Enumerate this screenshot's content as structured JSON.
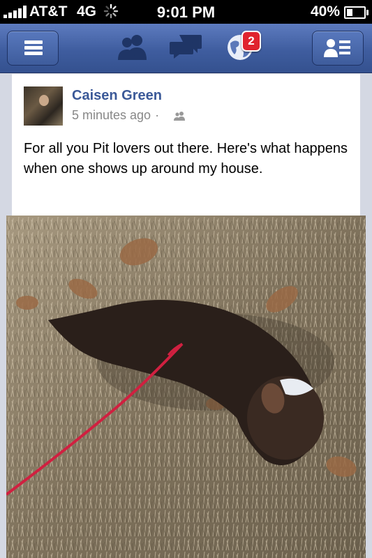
{
  "status_bar": {
    "carrier": "AT&T",
    "network": "4G",
    "time": "9:01 PM",
    "battery": "40%",
    "battery_level": 0.4
  },
  "nav": {
    "notification_count": "2",
    "icons": [
      "menu-icon",
      "friend-requests-icon",
      "messages-icon",
      "notifications-globe-icon",
      "friends-list-icon"
    ]
  },
  "post": {
    "author": "Caisen Green",
    "timestamp": "5 minutes ago",
    "separator": "·",
    "privacy": "friends-icon",
    "text": "For all you Pit lovers out there. Here's what happens when one shows up around my house."
  },
  "photo": {
    "description_icon": "post-photo"
  },
  "colors": {
    "nav_blue": "#3f5d9f",
    "author_blue": "#3b5998",
    "badge_red": "#e0242e",
    "background": "#d4d8e3"
  }
}
